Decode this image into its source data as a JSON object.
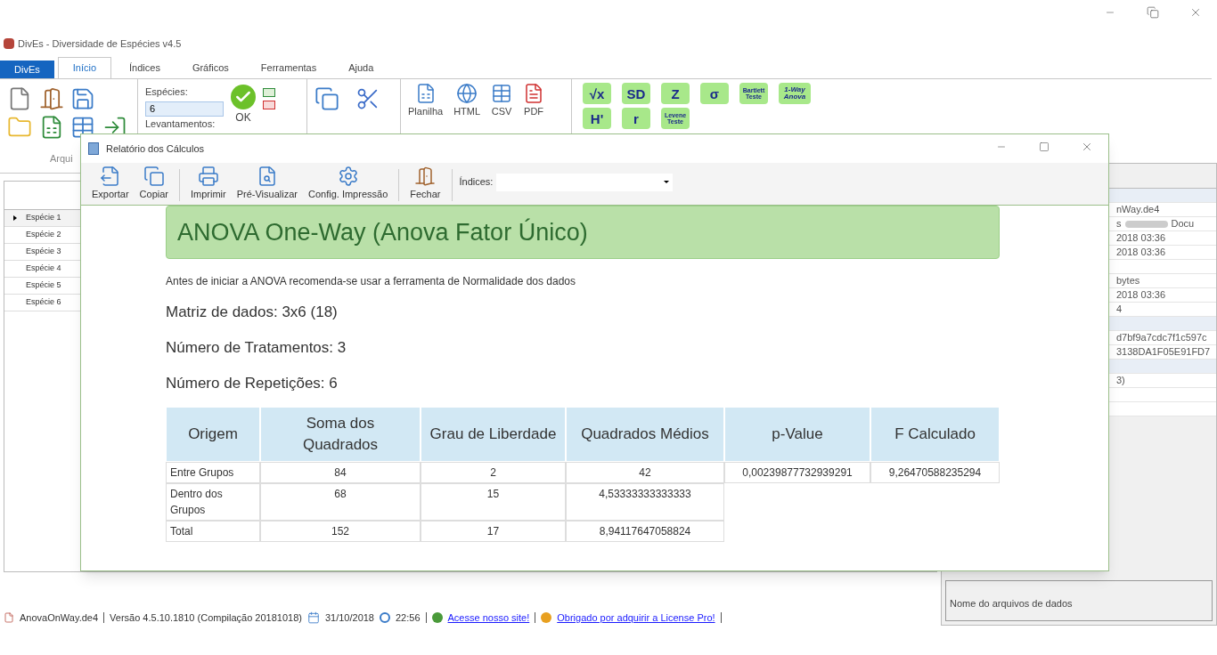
{
  "window": {
    "title": "DivEs - Diversidade de Espécies v4.5"
  },
  "ribbon_tabs": [
    {
      "label": "DivEs",
      "kind": "app",
      "selected": false
    },
    {
      "label": "Início",
      "kind": "tab",
      "selected": true
    },
    {
      "label": "Índices",
      "kind": "tab",
      "selected": false
    },
    {
      "label": "Gráficos",
      "kind": "tab",
      "selected": false
    },
    {
      "label": "Ferramentas",
      "kind": "tab",
      "selected": false
    },
    {
      "label": "Ajuda",
      "kind": "tab",
      "selected": false
    }
  ],
  "ribbon": {
    "group_label": "Arqui",
    "species_label": "Espécies:",
    "species_value": "6",
    "surveys_label": "Levantamentos:",
    "ok_label": "OK",
    "exports": [
      {
        "label": "Planilha",
        "kind": "sheet"
      },
      {
        "label": "HTML",
        "kind": "web"
      },
      {
        "label": "CSV",
        "kind": "csv"
      },
      {
        "label": "PDF",
        "kind": "pdf"
      }
    ],
    "stat_buttons": [
      {
        "label": "√x",
        "kind": "big"
      },
      {
        "label": "SD",
        "kind": "big"
      },
      {
        "label": "Z",
        "kind": "big"
      },
      {
        "label": "σ",
        "kind": "big"
      },
      {
        "label": "Bartlett Teste",
        "kind": "small"
      },
      {
        "label": "1-Way Anova",
        "kind": "anova"
      }
    ],
    "stat_buttons_row2": [
      {
        "label": "H'",
        "kind": "big"
      },
      {
        "label": "r",
        "kind": "big"
      },
      {
        "label": "Levene Teste",
        "kind": "small"
      }
    ]
  },
  "species_list": [
    {
      "name": "Espécie 1",
      "selected": true
    },
    {
      "name": "Espécie 2",
      "selected": false
    },
    {
      "name": "Espécie 3",
      "selected": false
    },
    {
      "name": "Espécie 4",
      "selected": false
    },
    {
      "name": "Espécie 5",
      "selected": false
    },
    {
      "name": "Espécie 6",
      "selected": false
    }
  ],
  "info_panel": {
    "rows": [
      {
        "kind": "header"
      },
      {
        "kind": "row",
        "text": "nWay.de4"
      },
      {
        "kind": "blurred",
        "text": "s",
        "tail": "Docu"
      },
      {
        "kind": "row",
        "text": "2018 03:36"
      },
      {
        "kind": "row",
        "text": "2018 03:36"
      },
      {
        "kind": "row"
      },
      {
        "kind": "row",
        "text": "bytes"
      },
      {
        "kind": "row",
        "text": "2018 03:36"
      },
      {
        "kind": "row",
        "text": "4"
      },
      {
        "kind": "header"
      },
      {
        "kind": "row",
        "text": "d7bf9a7cdc7f1c597c"
      },
      {
        "kind": "row",
        "text": "3138DA1F05E91FD7"
      },
      {
        "kind": "header"
      },
      {
        "kind": "row",
        "text": "3)"
      },
      {
        "kind": "row"
      },
      {
        "kind": "row"
      }
    ],
    "footer": "Nome do arquivos de dados"
  },
  "dialog": {
    "title": "Relatório dos Cálculos",
    "toolbar": [
      {
        "label": "Exportar",
        "kind": "export"
      },
      {
        "label": "Copiar",
        "kind": "copy"
      },
      {
        "label": "Imprimir",
        "kind": "print"
      },
      {
        "label": "Pré-Visualizar",
        "kind": "preview"
      },
      {
        "label": "Config. Impressão",
        "kind": "setup"
      },
      {
        "label": "Fechar",
        "kind": "close"
      }
    ],
    "indices_label": "Índices:",
    "heading": "ANOVA One-Way (Anova Fator Único)",
    "note": "Antes de iniciar a ANOVA recomenda-se usar a ferramenta de Normalidade dos dados",
    "lines": [
      "Matriz de dados: 3x6 (18)",
      "Número de Tratamentos: 3",
      "Número de Repetições: 6"
    ],
    "table": {
      "columns": [
        "Origem",
        "Soma dos Quadrados",
        "Grau de Liberdade",
        "Quadrados Médios",
        "p-Value",
        "F Calculado"
      ],
      "rows": [
        [
          "Entre Grupos",
          "84",
          "2",
          "42",
          "0,00239877732939291",
          "9,26470588235294"
        ],
        [
          "Dentro dos Grupos",
          "68",
          "15",
          "4,53333333333333"
        ],
        [
          "Total",
          "152",
          "17",
          "8,94117647058824"
        ]
      ]
    }
  },
  "status_bar": {
    "file": "AnovaOnWay.de4",
    "version": "Versão 4.5.10.1810 (Compilação 20181018)",
    "date": "31/10/2018",
    "time": "22:56",
    "site_link": "Acesse nosso site!",
    "license_link": "Obrigado por adquirir a License Pro!"
  }
}
